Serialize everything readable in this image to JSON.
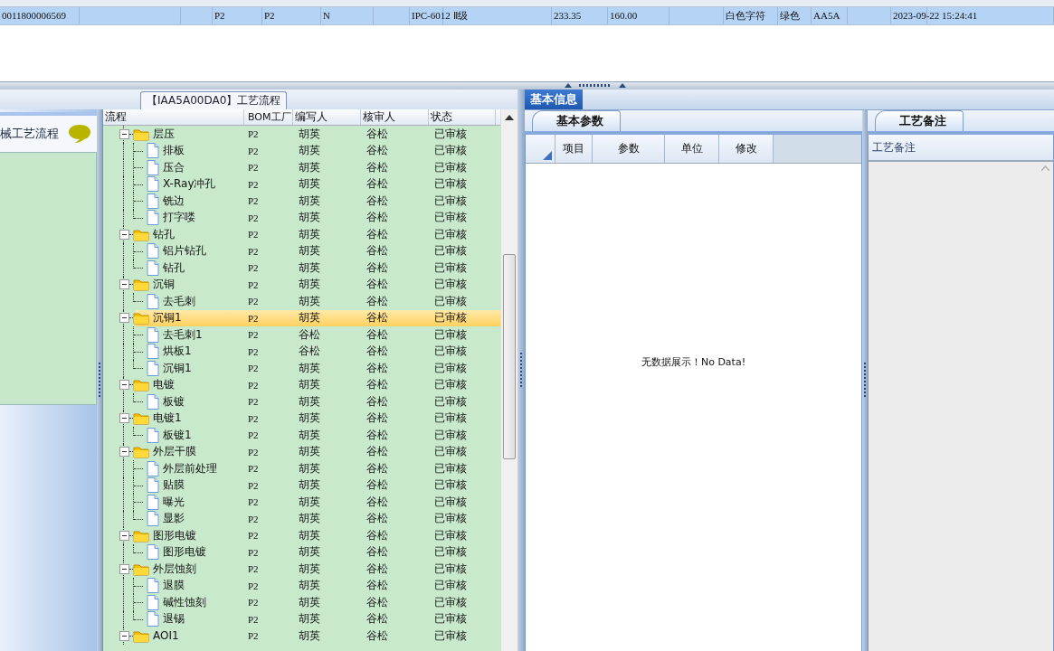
{
  "top_grid": {
    "selected_row": {
      "selected": true,
      "cells": [
        "0011800006569",
        "P2",
        "P2",
        "N",
        "IPC-6012 Ⅱ级",
        "233.35",
        "160.00",
        "白色字符",
        "绿色",
        "AA5A",
        "2023-09-22 15:24:41"
      ]
    }
  },
  "left_panel": {
    "title": "【IAA5A00DA0】工艺流程",
    "side_title": "械工艺流程"
  },
  "tree": {
    "columns": [
      "流程",
      "BOM工厂",
      "编写人",
      "核审人",
      "状态"
    ],
    "nodes": [
      {
        "name": "层压",
        "factory": "P2",
        "writer": "胡英",
        "reviewer": "谷松",
        "status": "已审核",
        "selected": false,
        "expanded": true,
        "children": [
          {
            "name": "排板",
            "factory": "P2",
            "writer": "胡英",
            "reviewer": "谷松",
            "status": "已审核",
            "selected": false
          },
          {
            "name": "压合",
            "factory": "P2",
            "writer": "胡英",
            "reviewer": "谷松",
            "status": "已审核",
            "selected": false
          },
          {
            "name": "X-Ray冲孔",
            "factory": "P2",
            "writer": "胡英",
            "reviewer": "谷松",
            "status": "已审核",
            "selected": false
          },
          {
            "name": "铣边",
            "factory": "P2",
            "writer": "胡英",
            "reviewer": "谷松",
            "status": "已审核",
            "selected": false
          },
          {
            "name": "打字喽",
            "factory": "P2",
            "writer": "胡英",
            "reviewer": "谷松",
            "status": "已审核",
            "selected": false
          }
        ]
      },
      {
        "name": "钻孔",
        "factory": "P2",
        "writer": "胡英",
        "reviewer": "谷松",
        "status": "已审核",
        "selected": false,
        "expanded": true,
        "children": [
          {
            "name": "铝片钻孔",
            "factory": "P2",
            "writer": "胡英",
            "reviewer": "谷松",
            "status": "已审核",
            "selected": false
          },
          {
            "name": "钻孔",
            "factory": "P2",
            "writer": "胡英",
            "reviewer": "谷松",
            "status": "已审核",
            "selected": false
          }
        ]
      },
      {
        "name": "沉铜",
        "factory": "P2",
        "writer": "胡英",
        "reviewer": "谷松",
        "status": "已审核",
        "selected": false,
        "expanded": true,
        "children": [
          {
            "name": "去毛刺",
            "factory": "P2",
            "writer": "胡英",
            "reviewer": "谷松",
            "status": "已审核",
            "selected": false
          }
        ]
      },
      {
        "name": "沉铜1",
        "factory": "P2",
        "writer": "胡英",
        "reviewer": "谷松",
        "status": "已审核",
        "selected": true,
        "expanded": true,
        "children": [
          {
            "name": "去毛刺1",
            "factory": "P2",
            "writer": "谷松",
            "reviewer": "谷松",
            "status": "已审核",
            "selected": false
          },
          {
            "name": "烘板1",
            "factory": "P2",
            "writer": "谷松",
            "reviewer": "谷松",
            "status": "已审核",
            "selected": false
          },
          {
            "name": "沉铜1",
            "factory": "P2",
            "writer": "胡英",
            "reviewer": "谷松",
            "status": "已审核",
            "selected": false
          }
        ]
      },
      {
        "name": "电镀",
        "factory": "P2",
        "writer": "胡英",
        "reviewer": "谷松",
        "status": "已审核",
        "selected": false,
        "expanded": true,
        "children": [
          {
            "name": "板镀",
            "factory": "P2",
            "writer": "胡英",
            "reviewer": "谷松",
            "status": "已审核",
            "selected": false
          }
        ]
      },
      {
        "name": "电镀1",
        "factory": "P2",
        "writer": "胡英",
        "reviewer": "谷松",
        "status": "已审核",
        "selected": false,
        "expanded": true,
        "children": [
          {
            "name": "板镀1",
            "factory": "P2",
            "writer": "胡英",
            "reviewer": "谷松",
            "status": "已审核",
            "selected": false
          }
        ]
      },
      {
        "name": "外层干膜",
        "factory": "P2",
        "writer": "胡英",
        "reviewer": "谷松",
        "status": "已审核",
        "selected": false,
        "expanded": true,
        "children": [
          {
            "name": "外层前处理",
            "factory": "P2",
            "writer": "胡英",
            "reviewer": "谷松",
            "status": "已审核",
            "selected": false
          },
          {
            "name": "贴膜",
            "factory": "P2",
            "writer": "胡英",
            "reviewer": "谷松",
            "status": "已审核",
            "selected": false
          },
          {
            "name": "曝光",
            "factory": "P2",
            "writer": "胡英",
            "reviewer": "谷松",
            "status": "已审核",
            "selected": false
          },
          {
            "name": "显影",
            "factory": "P2",
            "writer": "胡英",
            "reviewer": "谷松",
            "status": "已审核",
            "selected": false
          }
        ]
      },
      {
        "name": "图形电镀",
        "factory": "P2",
        "writer": "胡英",
        "reviewer": "谷松",
        "status": "已审核",
        "selected": false,
        "expanded": true,
        "children": [
          {
            "name": "图形电镀",
            "factory": "P2",
            "writer": "胡英",
            "reviewer": "谷松",
            "status": "已审核",
            "selected": false
          }
        ]
      },
      {
        "name": "外层蚀刻",
        "factory": "P2",
        "writer": "胡英",
        "reviewer": "谷松",
        "status": "已审核",
        "selected": false,
        "expanded": true,
        "children": [
          {
            "name": "退膜",
            "factory": "P2",
            "writer": "胡英",
            "reviewer": "谷松",
            "status": "已审核",
            "selected": false
          },
          {
            "name": "碱性蚀刻",
            "factory": "P2",
            "writer": "胡英",
            "reviewer": "谷松",
            "status": "已审核",
            "selected": false
          },
          {
            "name": "退锡",
            "factory": "P2",
            "writer": "胡英",
            "reviewer": "谷松",
            "status": "已审核",
            "selected": false
          }
        ]
      },
      {
        "name": "AOI1",
        "factory": "P2",
        "writer": "胡英",
        "reviewer": "谷松",
        "status": "已审核",
        "selected": false,
        "expanded": true
      }
    ]
  },
  "right_panel": {
    "tabs": [
      {
        "label": "基本信息",
        "selected": true
      }
    ],
    "params": {
      "tab": "基本参数",
      "columns": [
        "项目",
        "参数",
        "单位",
        "修改"
      ],
      "empty_message": "无数据展示！No Data!"
    },
    "notes": {
      "tab": "工艺备注",
      "column": "工艺备注"
    }
  }
}
